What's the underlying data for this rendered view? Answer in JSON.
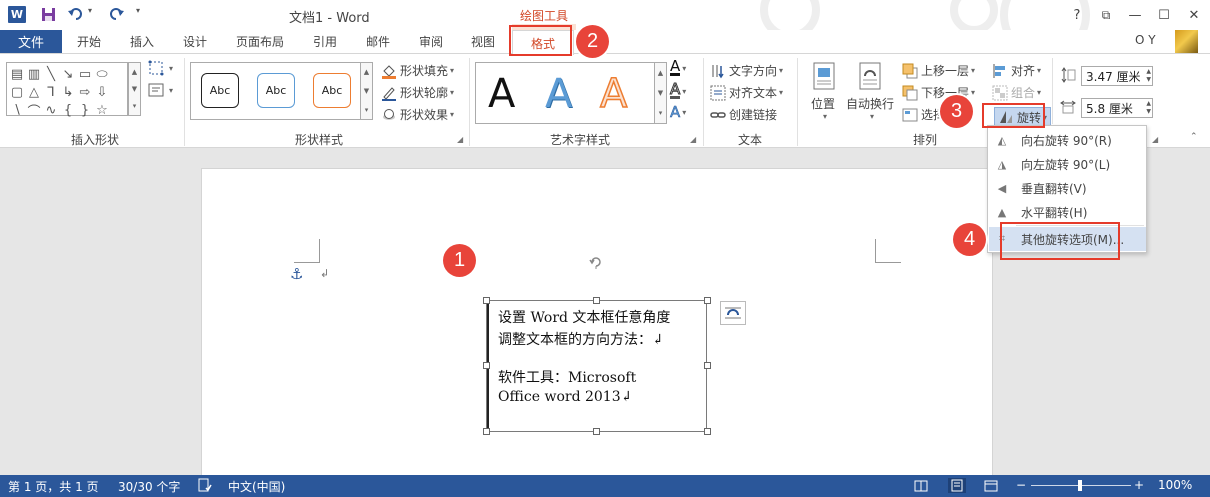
{
  "titlebar": {
    "title": "文档1 - Word",
    "app_icon": "W",
    "help": "?",
    "restore": "⧉",
    "minimize": "—",
    "maximize": "☐",
    "close": "✕"
  },
  "tabs": {
    "file": "文件",
    "home": "开始",
    "insert": "插入",
    "design": "设计",
    "layout": "页面布局",
    "references": "引用",
    "mailings": "邮件",
    "review": "审阅",
    "view": "视图",
    "context_group": "绘图工具",
    "format": "格式",
    "user": "O Y"
  },
  "ribbon": {
    "insert_shapes": {
      "label": "插入形状"
    },
    "shape_styles": {
      "label": "形状样式",
      "presets": [
        "Abc",
        "Abc",
        "Abc"
      ],
      "fill": "形状填充",
      "outline": "形状轮廓",
      "effects": "形状效果"
    },
    "wordart_styles": {
      "label": "艺术字样式",
      "letter": "A"
    },
    "text": {
      "label": "文本",
      "direction": "文字方向",
      "align": "对齐文本",
      "link": "创建链接"
    },
    "arrange": {
      "label": "排列",
      "position": "位置",
      "wrap": "自动换行",
      "forward": "上移一层",
      "backward": "下移一层",
      "selection": "选择",
      "align": "对齐",
      "group": "组合",
      "rotate": "旋转"
    },
    "size": {
      "height": "3.47 厘米",
      "width": "5.8 厘米"
    }
  },
  "rotate_menu": {
    "items": [
      "向右旋转 90°(R)",
      "向左旋转 90°(L)",
      "垂直翻转(V)",
      "水平翻转(H)",
      "其他旋转选项(M)..."
    ]
  },
  "textbox": {
    "lines": [
      "设置 Word 文本框任意角度",
      "调整文本框的方向方法：↲",
      "软件工具：Microsoft",
      "Office word 2013↲"
    ]
  },
  "document": {
    "para_mark": "↲"
  },
  "callouts": [
    "1",
    "2",
    "3",
    "4"
  ],
  "statusbar": {
    "page": "第 1 页，共 1 页",
    "words": "30/30 个字",
    "language": "中文(中国)",
    "zoom": "100%",
    "zoom_minus": "−",
    "zoom_plus": "+"
  },
  "colors": {
    "word_blue": "#2b579a",
    "context_orange": "#d24726",
    "callout_red": "#e8443a",
    "menu_hover": "#d5e1f2"
  },
  "icons": [
    "word-logo-icon",
    "save-icon",
    "undo-icon",
    "redo-icon",
    "anchor-icon",
    "rotate-handle-icon",
    "layout-options-icon"
  ]
}
